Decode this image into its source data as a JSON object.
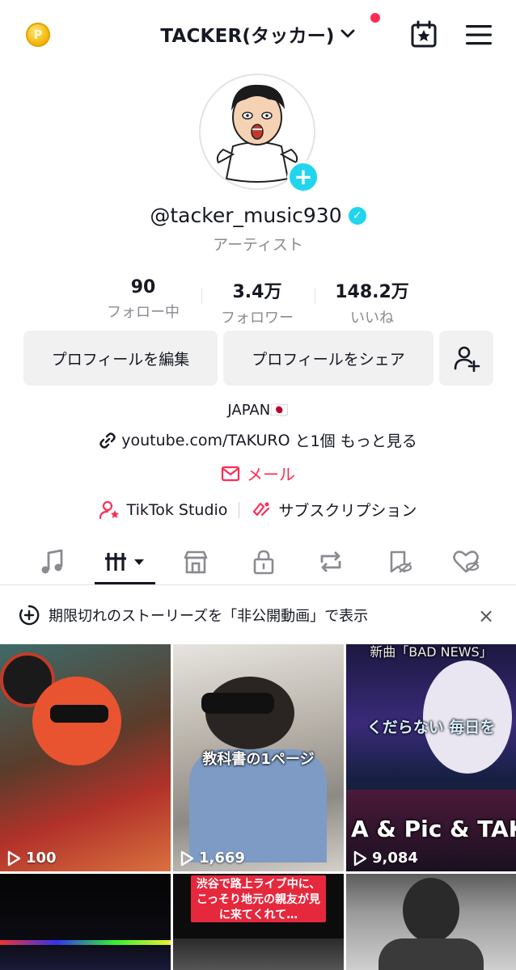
{
  "header": {
    "title": "TACKER(タッカー)",
    "coin_letter": "P"
  },
  "profile": {
    "handle": "@tacker_music930",
    "category": "アーティスト"
  },
  "stats": [
    {
      "value": "90",
      "label": "フォロー中"
    },
    {
      "value": "3.4万",
      "label": "フォロワー"
    },
    {
      "value": "148.2万",
      "label": "いいね"
    }
  ],
  "buttons": {
    "edit": "プロフィールを編集",
    "share": "プロフィールをシェア"
  },
  "bio": {
    "country": "JAPAN🇯🇵",
    "link_text": "youtube.com/TAKURO",
    "link_more": "と1個 もっと見る",
    "email_label": "メール",
    "studio": "TikTok Studio",
    "subscription": "サブスクリプション"
  },
  "notice": {
    "text": "期限切れのストーリーズを「非公開動画」で表示",
    "close": "×"
  },
  "videos": [
    {
      "views": "100",
      "overlay": ""
    },
    {
      "views": "1,669",
      "overlay": "教科書の1ページ"
    },
    {
      "views": "9,084",
      "overlay": "くだらない 毎日を",
      "top_caption": "新曲「BAD NEWS」",
      "bottom_caption": "A & Pic & TAKI"
    },
    {
      "views": "",
      "overlay": ""
    },
    {
      "views": "",
      "overlay": "渋谷で路上ライブ中に、こっそり地元の親友が見に来てくれて…"
    },
    {
      "views": "",
      "overlay": ""
    }
  ],
  "colors": {
    "accent_red": "#fe2c55",
    "accent_cyan": "#20d5ec",
    "button_bg": "#f1f1f2",
    "muted_text": "#8a8b91"
  }
}
